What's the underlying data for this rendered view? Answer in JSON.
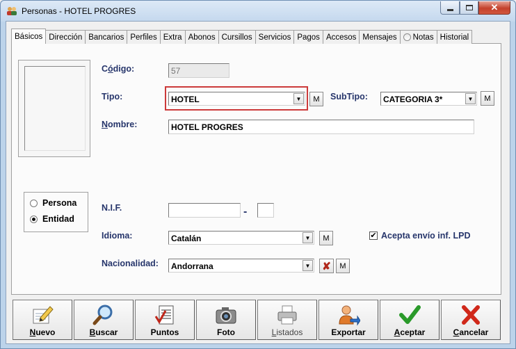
{
  "window": {
    "title": "Personas - HOTEL PROGRES"
  },
  "tabs": [
    {
      "label": "Básicos"
    },
    {
      "label": "Dirección"
    },
    {
      "label": "Bancarios"
    },
    {
      "label": "Perfiles"
    },
    {
      "label": "Extra"
    },
    {
      "label": "Abonos"
    },
    {
      "label": "Cursillos"
    },
    {
      "label": "Servicios"
    },
    {
      "label": "Pagos"
    },
    {
      "label": "Accesos"
    },
    {
      "label": "Mensajes"
    },
    {
      "label": "Notas"
    },
    {
      "label": "Historial"
    }
  ],
  "form": {
    "codigo": {
      "label_pre": "C",
      "label_ul": "ó",
      "label_post": "digo:",
      "value": "57"
    },
    "tipo": {
      "label": "Tipo:",
      "value": "HOTEL",
      "m_label": "M"
    },
    "subtipo": {
      "label": "SubTipo:",
      "value": "CATEGORIA 3*",
      "m_label": "M"
    },
    "nombre": {
      "label_ul": "N",
      "label_post": "ombre:",
      "value": "HOTEL PROGRES"
    },
    "persona_option": "Persona",
    "entidad_option": "Entidad",
    "nif": {
      "label": "N.I.F.",
      "value": "",
      "dash": "-",
      "suffix": ""
    },
    "idioma": {
      "label": "Idioma:",
      "value": "Catalán",
      "m_label": "M"
    },
    "nacionalidad": {
      "label": "Nacionalidad:",
      "value": "Andorrana",
      "m_label": "M"
    },
    "lpd": {
      "label": "Acepta envío inf. LPD",
      "checked": true
    }
  },
  "toolbar": {
    "nuevo": {
      "ul": "N",
      "rest": "uevo"
    },
    "buscar": {
      "ul": "B",
      "rest": "uscar"
    },
    "puntos": "Puntos",
    "foto": "Foto",
    "listados": {
      "ul": "L",
      "rest": "istados"
    },
    "exportar": "Exportar",
    "aceptar": {
      "ul": "A",
      "rest": "ceptar"
    },
    "cancelar": {
      "ul": "C",
      "rest": "ancelar"
    }
  },
  "icons": {
    "app": "people-icon",
    "nuevo": "pencil-paper-icon",
    "buscar": "magnifier-icon",
    "puntos": "checklist-icon",
    "foto": "camera-icon",
    "listados": "printer-icon",
    "exportar": "user-export-icon",
    "aceptar": "checkmark-icon",
    "cancelar": "red-x-icon"
  }
}
